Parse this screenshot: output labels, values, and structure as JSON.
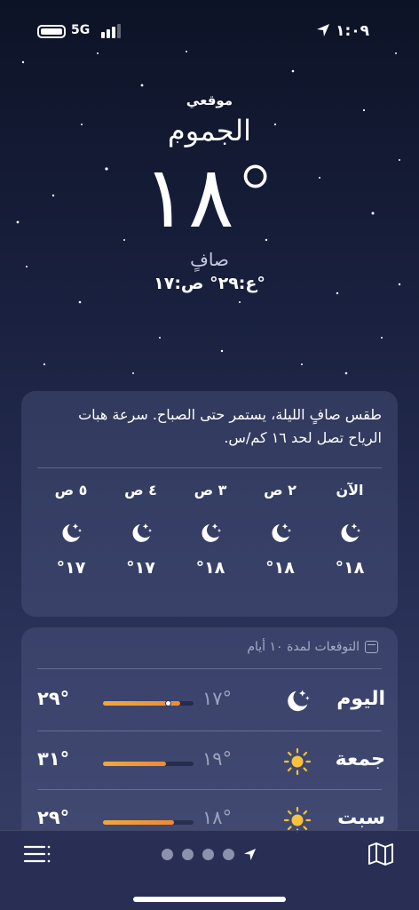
{
  "status": {
    "network": "5G",
    "time": "١:٠٩"
  },
  "header": {
    "my_location": "موقعي",
    "city": "الجموم",
    "temperature": "١٨°",
    "condition": "صافٍ",
    "high_low": "ع:٢٩°  ص:١٧°"
  },
  "hourly": {
    "summary": "طقس صافٍ الليلة، يستمر حتى الصباح. سرعة هبات الرياح تصل لحد ١٦ كم/س.",
    "items": [
      {
        "label": "الآن",
        "icon": "moon-stars-icon",
        "temp": "١٨°"
      },
      {
        "label": "٢ ص",
        "icon": "moon-stars-icon",
        "temp": "١٨°"
      },
      {
        "label": "٣ ص",
        "icon": "moon-stars-icon",
        "temp": "١٨°"
      },
      {
        "label": "٤ ص",
        "icon": "moon-stars-icon",
        "temp": "١٧°"
      },
      {
        "label": "٥ ص",
        "icon": "moon-stars-icon",
        "temp": "١٧°"
      }
    ]
  },
  "forecast": {
    "title": "التوقعات لمدة ١٠ أيام",
    "days": [
      {
        "day": "اليوم",
        "icon": "moon-stars-icon",
        "low": "١٧°",
        "high": "٢٩°",
        "range_start": 0.0,
        "range_end": 0.85,
        "current": 0.72
      },
      {
        "day": "جمعة",
        "icon": "sun-icon",
        "low": "١٩°",
        "high": "٣١°",
        "range_start": 0.0,
        "range_end": 0.7
      },
      {
        "day": "سبت",
        "icon": "sun-icon",
        "low": "١٨°",
        "high": "٢٩°",
        "range_start": 0.0,
        "range_end": 0.78
      }
    ]
  },
  "colors": {
    "moon": "#ffffff",
    "sun": "#f7c23c",
    "bar_warm": "#f0a83a",
    "bar_hot": "#ee8a35"
  }
}
